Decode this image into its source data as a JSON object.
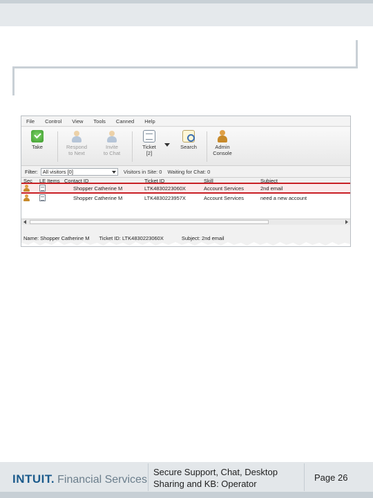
{
  "menu": [
    "File",
    "Control",
    "View",
    "Tools",
    "Canned",
    "Help"
  ],
  "toolbar": {
    "take": "Take",
    "respond_next": [
      "Respond",
      "to Next"
    ],
    "invite_chat": [
      "Invite",
      "to Chat"
    ],
    "ticket": [
      "Ticket",
      "[2]"
    ],
    "search": "Search",
    "admin_console": [
      "Admin",
      "Console"
    ]
  },
  "filter": {
    "label": "Filter:",
    "selected": "All visitors [0]",
    "visitors_in_site": "Visitors in Site: 0",
    "waiting_for_chat": "Waiting for Chat: 0"
  },
  "grid": {
    "columns": [
      "Sec",
      "LE Items",
      "Contact ID",
      "Ticket ID",
      "Skill",
      "Subject"
    ],
    "rows": [
      {
        "contact": "Shopper Catherine M",
        "ticket": "LTK4830223060X",
        "skill": "Account Services",
        "subject": "2nd email",
        "selected": true
      },
      {
        "contact": "Shopper Catherine M",
        "ticket": "LTK4830223957X",
        "skill": "Account Services",
        "subject": "need a new account",
        "selected": false
      }
    ]
  },
  "status": {
    "name": "Name: Shopper Catherine M",
    "ticket": "Ticket ID: LTK4830223060X",
    "subject": "Subject: 2nd email"
  },
  "footer": {
    "logo_intuit": "INTUIT.",
    "logo_fs": "Financial Services",
    "title_line1": "Secure Support, Chat, Desktop",
    "title_line2": "Sharing and KB: Operator",
    "page": "Page 26"
  },
  "colors": {
    "selection_outline": "#c81f25",
    "brand_blue": "#1c5b8c",
    "band_gray": "#e3e7ea"
  }
}
